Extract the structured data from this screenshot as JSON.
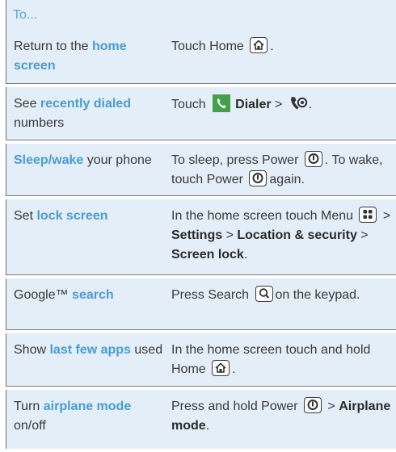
{
  "header": {
    "label": "To..."
  },
  "rows": [
    {
      "task": [
        "Return to the ",
        "home screen"
      ],
      "action": [
        "Touch Home",
        "."
      ]
    },
    {
      "task": [
        "See ",
        "recently dialed",
        " numbers"
      ],
      "action": [
        "Touch",
        "Dialer",
        " > ",
        "."
      ]
    },
    {
      "task": [
        "Sleep/wake",
        " your phone"
      ],
      "action": [
        "To sleep, press Power",
        ". To wake, touch Power",
        "again."
      ]
    },
    {
      "task": [
        "Set ",
        "lock screen"
      ],
      "action": [
        "In the home screen touch Menu",
        " > ",
        "Settings",
        " > ",
        "Location & security",
        " > ",
        "Screen lock",
        "."
      ]
    },
    {
      "task": [
        "Google™ ",
        "search"
      ],
      "action": [
        "Press Search",
        "on the keypad."
      ]
    },
    {
      "task": [
        "Show ",
        "last few apps",
        " used"
      ],
      "action": [
        "In the home screen touch and hold Home",
        "."
      ]
    },
    {
      "task": [
        "Turn ",
        "airplane mode",
        " on/off"
      ],
      "action": [
        "Press and hold Power",
        " > ",
        "Airplane mode",
        "."
      ]
    }
  ],
  "icons": [
    "home-key-icon",
    "dialer-icon",
    "recent-calls-icon",
    "power-key-icon",
    "menu-key-icon",
    "search-key-icon"
  ],
  "colors": {
    "highlight": "#4a9bd4",
    "row_bg": "#e3eef8",
    "dialer_green": "#43a047",
    "text": "#3a3a3a"
  }
}
